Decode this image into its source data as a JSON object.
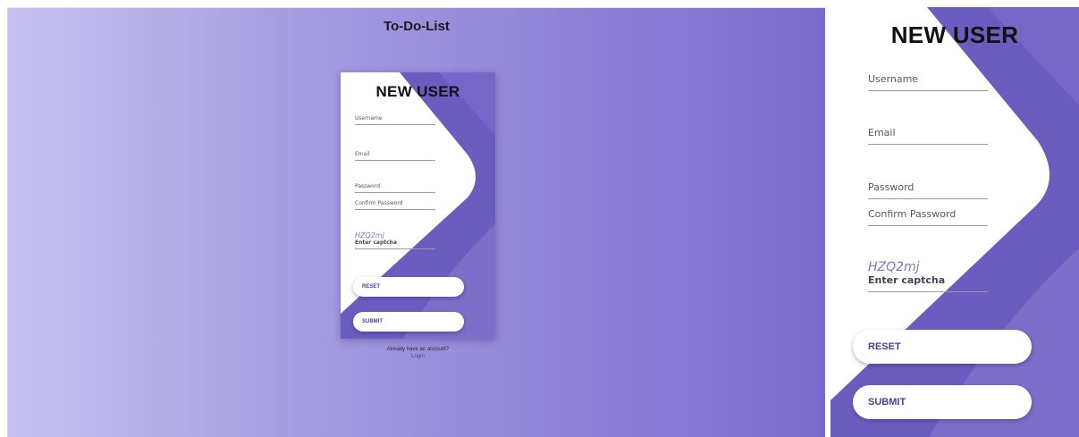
{
  "app": {
    "title": "To-Do-List"
  },
  "form": {
    "title": "NEW USER",
    "fields": {
      "username": "Username",
      "email": "Email",
      "password": "Password",
      "confirm_password": "Confirm Password"
    },
    "captcha": {
      "code": "HZQ2mj",
      "label": "Enter captcha"
    },
    "buttons": {
      "reset": "RESET",
      "submit": "SUBMIT"
    }
  },
  "footer": {
    "prompt": "Already have an account?",
    "login": "Login"
  },
  "colors": {
    "accent": "#6a5acd",
    "accent_dark": "#5d4fb8",
    "button_text": "#4b3f9a"
  }
}
